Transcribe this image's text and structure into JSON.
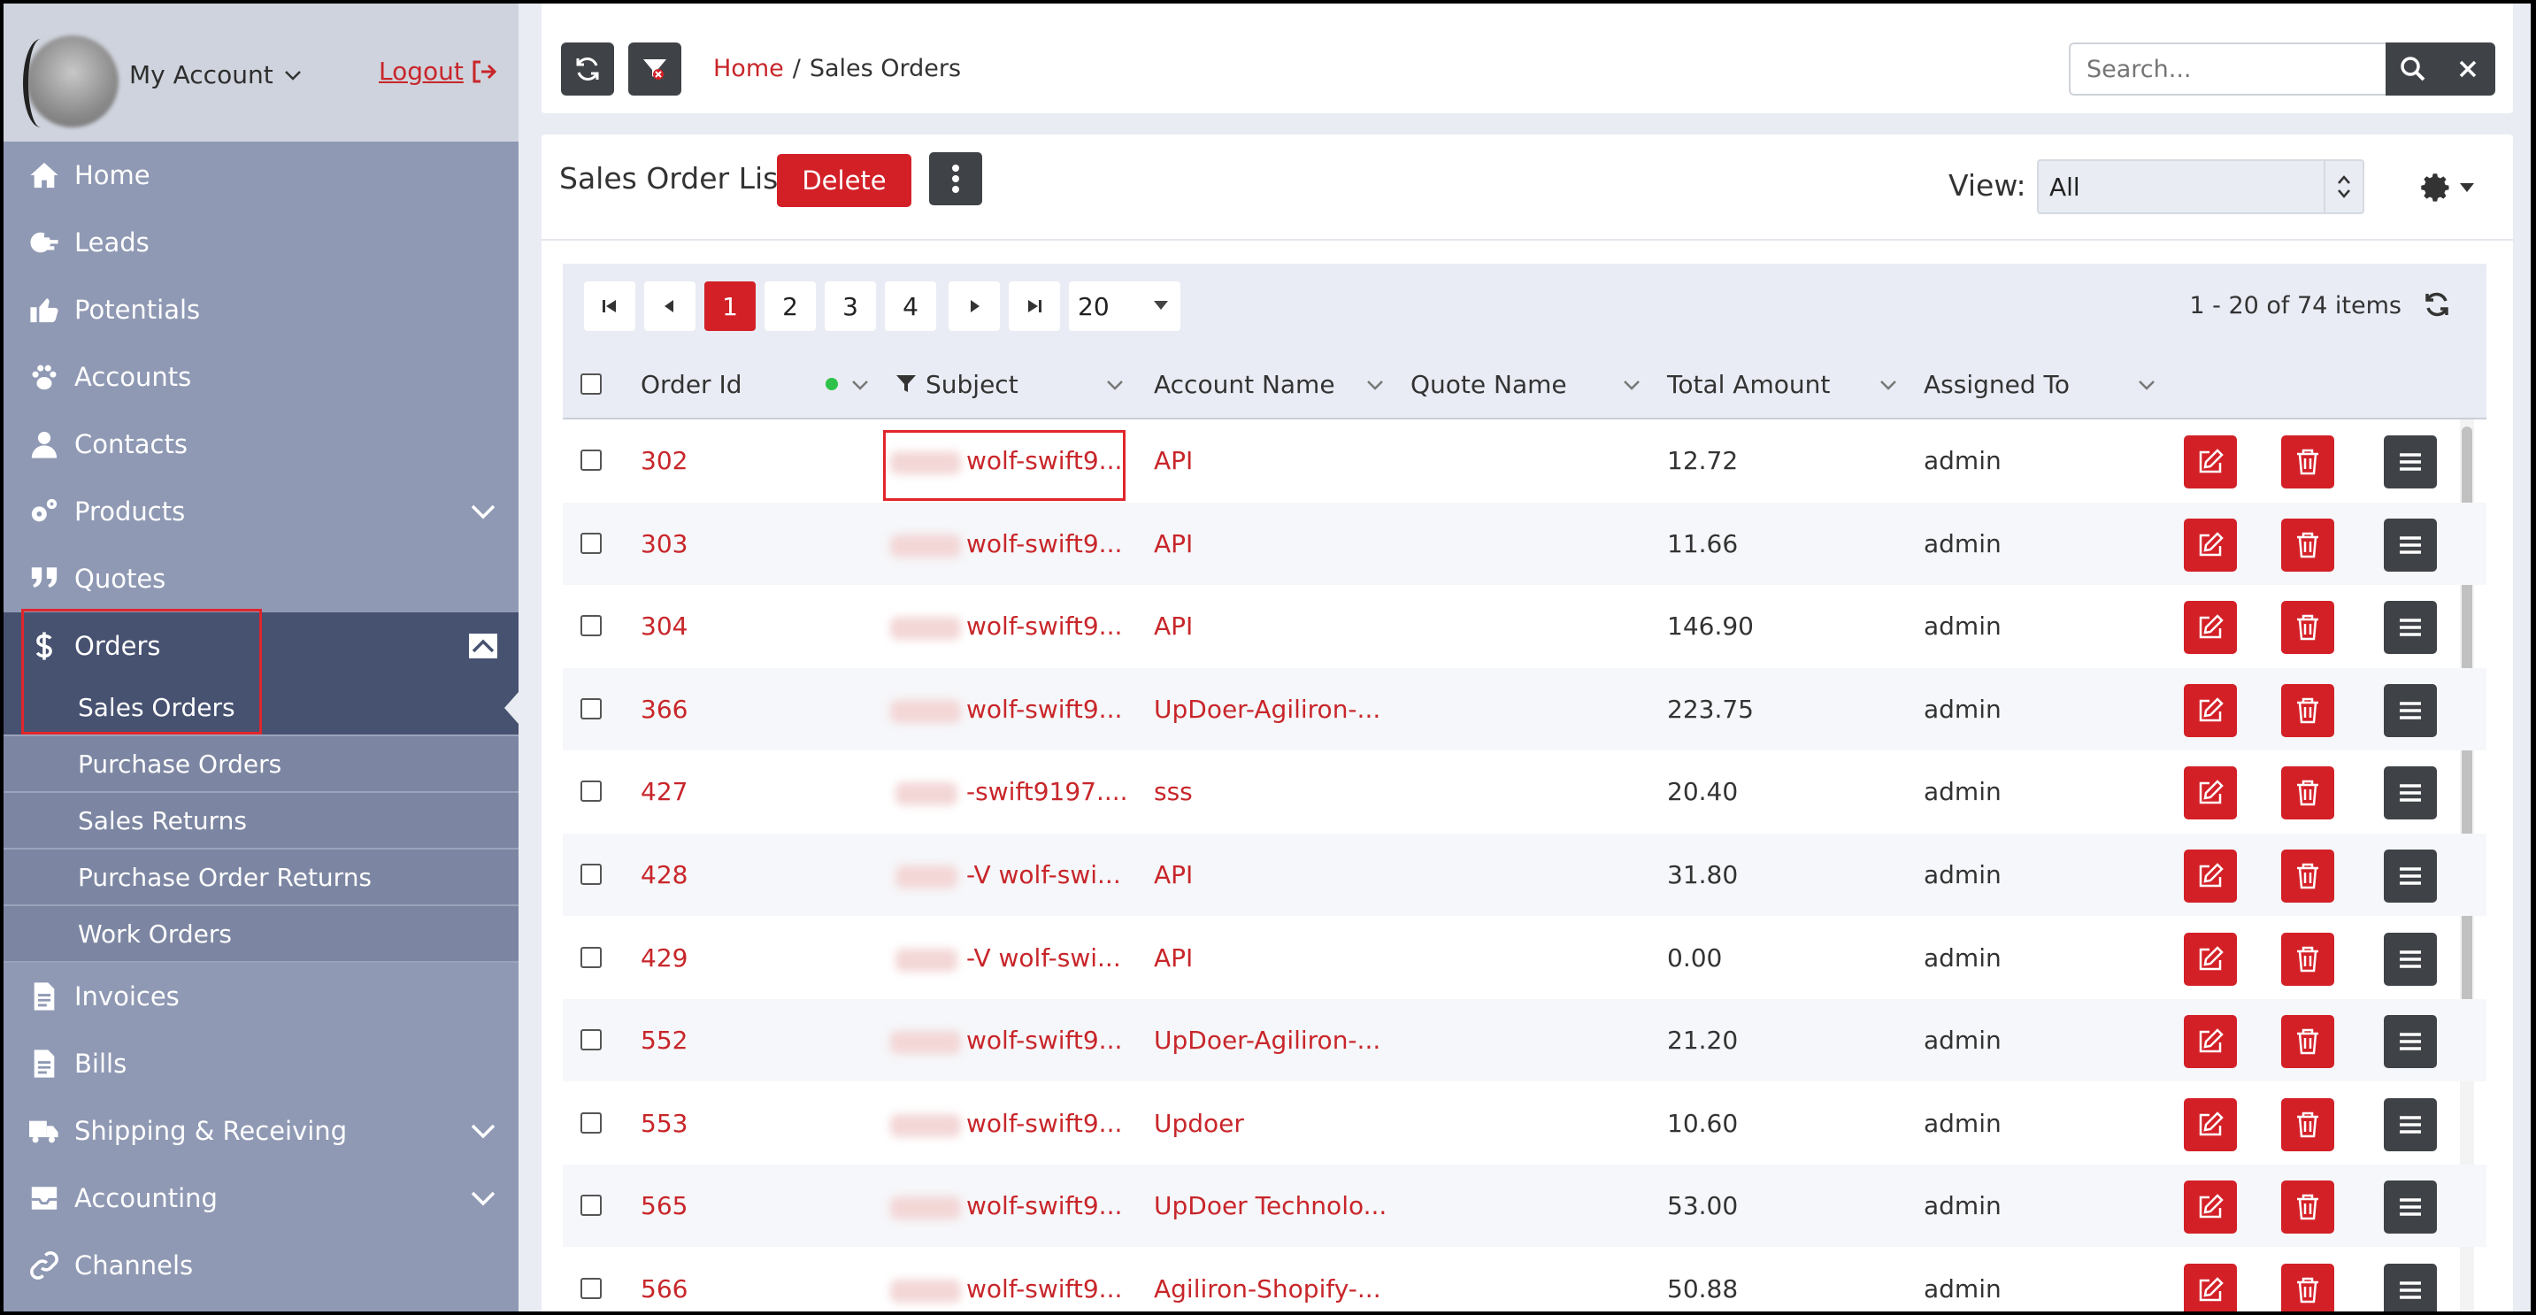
{
  "account": {
    "label": "My Account",
    "logout": "Logout"
  },
  "nav": {
    "items": [
      {
        "label": "Home",
        "icon": "home-icon"
      },
      {
        "label": "Leads",
        "icon": "leads-icon"
      },
      {
        "label": "Potentials",
        "icon": "thumbs-up-icon"
      },
      {
        "label": "Accounts",
        "icon": "paw-icon"
      },
      {
        "label": "Contacts",
        "icon": "user-icon"
      },
      {
        "label": "Products",
        "icon": "cogs-icon"
      },
      {
        "label": "Quotes",
        "icon": "quote-icon"
      },
      {
        "label": "Orders",
        "icon": "dollar-icon"
      }
    ],
    "orders_sub": [
      "Sales Orders",
      "Purchase Orders",
      "Sales Returns",
      "Purchase Order Returns",
      "Work Orders"
    ],
    "bottom": [
      {
        "label": "Invoices",
        "icon": "file-icon"
      },
      {
        "label": "Bills",
        "icon": "file-icon"
      },
      {
        "label": "Shipping & Receiving",
        "icon": "truck-icon"
      },
      {
        "label": "Accounting",
        "icon": "inbox-icon"
      },
      {
        "label": "Channels",
        "icon": "link-icon"
      }
    ]
  },
  "breadcrumb": {
    "home": "Home",
    "sep": "/",
    "current": "Sales Orders"
  },
  "search": {
    "placeholder": "Search..."
  },
  "panel": {
    "title": "Sales Order List",
    "delete": "Delete",
    "view_label": "View:",
    "view_value": "All"
  },
  "pager": {
    "pages": [
      "1",
      "2",
      "3",
      "4"
    ],
    "current": "1",
    "page_size": "20",
    "info": "1 - 20 of 74 items"
  },
  "columns": [
    "Order Id",
    "Subject",
    "Account Name",
    "Quote Name",
    "Total Amount",
    "Assigned To"
  ],
  "rows": [
    {
      "id": "302",
      "subject": "wolf-swift9...",
      "account": "API",
      "total": "12.72",
      "assigned": "admin"
    },
    {
      "id": "303",
      "subject": "wolf-swift9...",
      "account": "API",
      "total": "11.66",
      "assigned": "admin"
    },
    {
      "id": "304",
      "subject": "wolf-swift9...",
      "account": "API",
      "total": "146.90",
      "assigned": "admin"
    },
    {
      "id": "366",
      "subject": "wolf-swift9...",
      "account": "UpDoer-Agiliron-...",
      "total": "223.75",
      "assigned": "admin"
    },
    {
      "id": "427",
      "subject": "-swift9197....",
      "account": "sss",
      "total": "20.40",
      "assigned": "admin"
    },
    {
      "id": "428",
      "subject": "-V wolf-swi...",
      "account": "API",
      "total": "31.80",
      "assigned": "admin"
    },
    {
      "id": "429",
      "subject": "-V wolf-swi...",
      "account": "API",
      "total": "0.00",
      "assigned": "admin"
    },
    {
      "id": "552",
      "subject": "wolf-swift9...",
      "account": "UpDoer-Agiliron-...",
      "total": "21.20",
      "assigned": "admin"
    },
    {
      "id": "553",
      "subject": "wolf-swift9...",
      "account": "Updoer",
      "total": "10.60",
      "assigned": "admin"
    },
    {
      "id": "565",
      "subject": "wolf-swift9...",
      "account": "UpDoer Technolo...",
      "total": "53.00",
      "assigned": "admin"
    },
    {
      "id": "566",
      "subject": "wolf-swift9...",
      "account": "Agiliron-Shopify-...",
      "total": "50.88",
      "assigned": "admin"
    }
  ],
  "colors": {
    "accent": "#d32027",
    "sidebar": "#8f99b4",
    "sidebar_active": "#475170",
    "dark_button": "#3f4347"
  }
}
